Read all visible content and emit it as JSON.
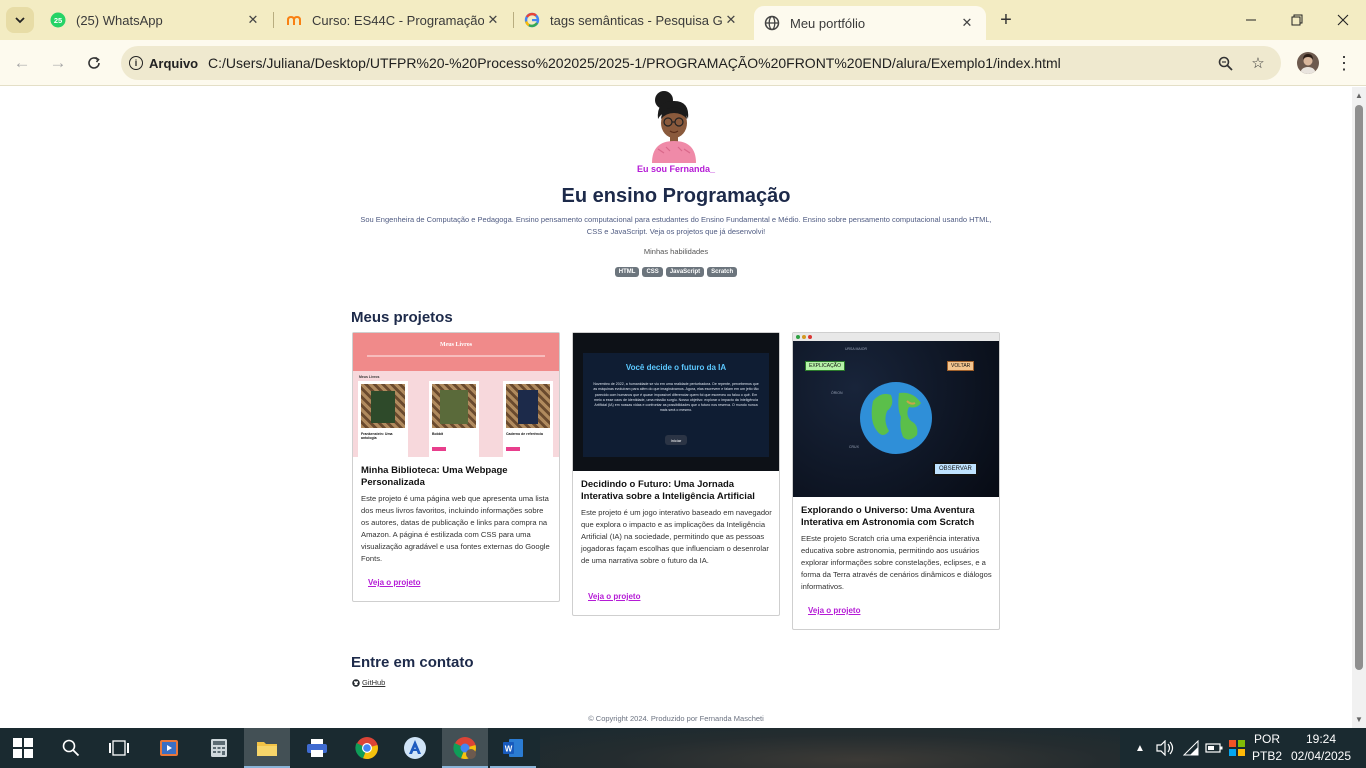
{
  "browser": {
    "tabs": [
      {
        "title": "(25) WhatsApp",
        "badge": "25"
      },
      {
        "title": "Curso: ES44C - Programação W"
      },
      {
        "title": "tags semânticas - Pesquisa Goo"
      },
      {
        "title": "Meu portfólio"
      }
    ],
    "security_label": "Arquivo",
    "url": "C:/Users/Juliana/Desktop/UTFPR%20-%20Processo%202025/2025-1/PROGRAMAÇÃO%20FRONT%20END/alura/Exemplo1/index.html"
  },
  "page": {
    "hello": "Eu sou Fernanda_",
    "headline": "Eu ensino Programação",
    "intro": "Sou Engenheira de Computação e Pedagoga. Ensino pensamento computacional para estudantes do Ensino Fundamental e Médio. Ensino sobre pensamento computacional usando HTML, CSS e JavaScript. Veja os projetos que já desenvolvi!",
    "skills_title": "Minhas habilidades",
    "skills": [
      "HTML",
      "CSS",
      "JavaScript",
      "Scratch"
    ],
    "projects_title": "Meus projetos",
    "projects": [
      {
        "title": "Minha Biblioteca: Uma Webpage Personalizada",
        "description": "Este projeto é uma página web que apresenta uma lista dos meus livros favoritos, incluindo informações sobre os autores, datas de publicação e links para compra na Amazon. A página é estilizada com CSS para uma visualização agradável e usa fontes externas do Google Fonts.",
        "link": "Veja o projeto",
        "thumb": {
          "header": "Meus Livros",
          "section": "Meus Livros",
          "books": [
            "Frankenstein: Uma antologia",
            "Bobbit",
            "Caderno de referência"
          ]
        }
      },
      {
        "title": "Decidindo o Futuro: Uma Jornada Interativa sobre a Inteligência Artificial",
        "description": "Este projeto é um jogo interativo baseado em navegador que explora o impacto e as implicações da Inteligência Artificial (IA) na sociedade, permitindo que as pessoas jogadoras façam escolhas que influenciam o desenrolar de uma narrativa sobre o futuro da IA.",
        "link": "Veja o projeto",
        "thumb": {
          "title": "Você decide o futuro da IA",
          "text": "Novembro de 2022, a humanidade se viu em uma realidade perturbadora. De repente, percebemos que as máquinas evoluíram para além do que imaginávamos. Agora, elas escrevem e falam em um jeito tão parecido com humanos que é quase impossível diferenciar quem foi que escreveu ou falou o quê. Em meio a esse caos de identidade, uma missão surgiu. Nosso objetivo: explorar o impacto da Inteligência Artificial (IA) em nossas vidas e confrontar as possibilidades que o futuro nos reserva. O mundo nunca mais será o mesmo.",
          "button": "Iniciar"
        }
      },
      {
        "title": "Explorando o Universo: Uma Aventura Interativa em Astronomia com Scratch",
        "description": "EEste projeto Scratch cria uma experiência interativa educativa sobre astronomia, permitindo aos usuários explorar informações sobre constelações, eclipses, e a forma da Terra através de cenários dinâmicos e diálogos informativos.",
        "link": "Veja o projeto",
        "thumb": {
          "explain": "EXPLICAÇÃO",
          "back": "VOLTAR",
          "observe": "OBSERVAR",
          "star_labels": [
            "URSA MAIOR",
            "ÓRION",
            "CRUX"
          ]
        }
      }
    ],
    "contact_title": "Entre em contato",
    "contact_link": "GitHub",
    "footer": "© Copyright 2024. Produzido por Fernanda Mascheti"
  },
  "taskbar": {
    "language": "POR",
    "layout": "PTB2",
    "time": "19:24",
    "date": "02/04/2025"
  },
  "colors": {
    "accent": "#b51bd6",
    "heading": "#1d2a4a",
    "tabstrip": "#f3ecc3",
    "skill_badge": "#6c757d"
  }
}
